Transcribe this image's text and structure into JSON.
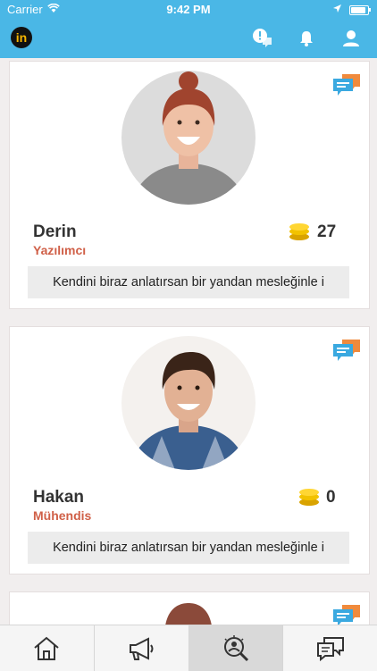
{
  "status_bar": {
    "carrier": "Carrier",
    "time": "9:42 PM"
  },
  "header": {
    "logo_text": "in",
    "icons": [
      "alert-bubble-icon",
      "bell-icon",
      "user-icon"
    ]
  },
  "profiles": [
    {
      "name": "Derin",
      "profession": "Yazılımcı",
      "coins": "27",
      "bio": "Kendini biraz anlatırsan bir yandan mesleğinle i"
    },
    {
      "name": "Hakan",
      "profession": "Mühendis",
      "coins": "0",
      "bio": "Kendini biraz anlatırsan bir yandan mesleğinle i"
    }
  ],
  "tabbar": {
    "tabs": [
      "home-icon",
      "megaphone-icon",
      "search-people-icon",
      "messages-icon"
    ],
    "active_index": 2
  },
  "colors": {
    "header": "#4ab7e6",
    "profession": "#d06048",
    "coin": "#f2c200",
    "accent_chat_blue": "#3aa9e0",
    "accent_chat_orange": "#f08a3c"
  }
}
